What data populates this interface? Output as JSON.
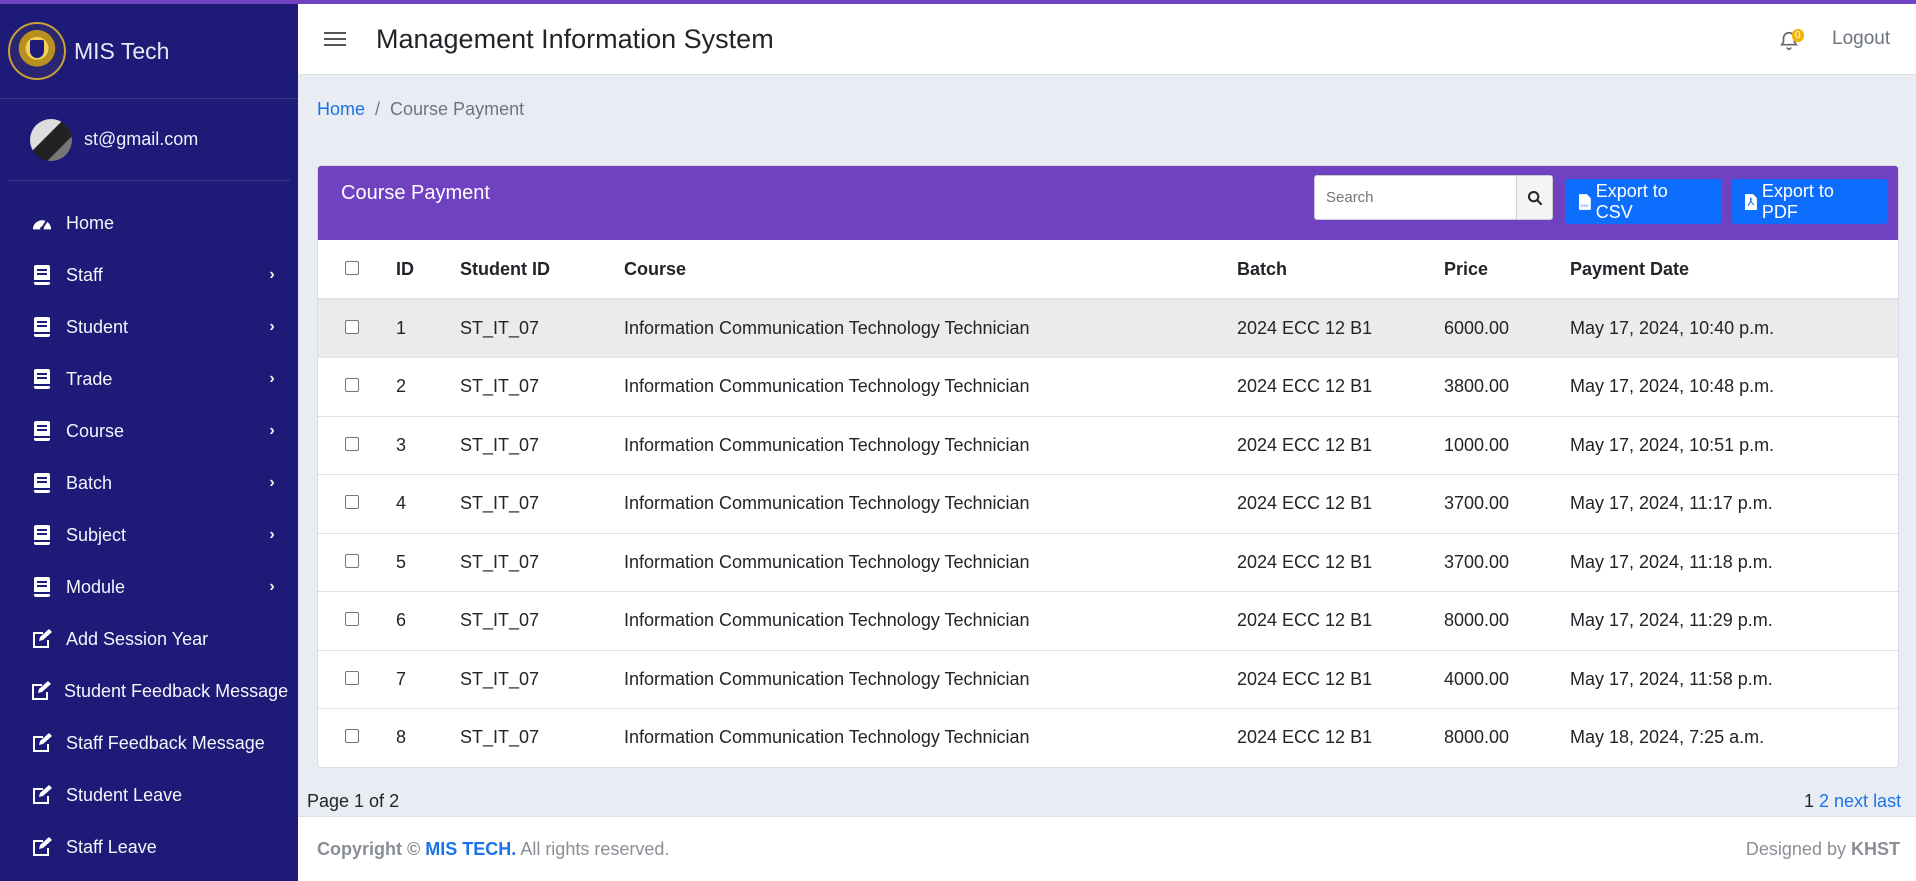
{
  "brand": {
    "name": "MIS Tech"
  },
  "user": {
    "email": "st@gmail.com"
  },
  "sidebar": {
    "items": [
      {
        "label": "Home",
        "icon": "dashboard-icon",
        "has_submenu": false
      },
      {
        "label": "Staff",
        "icon": "book-icon",
        "has_submenu": true
      },
      {
        "label": "Student",
        "icon": "book-icon",
        "has_submenu": true
      },
      {
        "label": "Trade",
        "icon": "book-icon",
        "has_submenu": true
      },
      {
        "label": "Course",
        "icon": "book-icon",
        "has_submenu": true
      },
      {
        "label": "Batch",
        "icon": "book-icon",
        "has_submenu": true
      },
      {
        "label": "Subject",
        "icon": "book-icon",
        "has_submenu": true
      },
      {
        "label": "Module",
        "icon": "book-icon",
        "has_submenu": true
      },
      {
        "label": "Add Session Year",
        "icon": "edit-icon",
        "has_submenu": false
      },
      {
        "label": "Student Feedback Message",
        "icon": "edit-icon",
        "has_submenu": false
      },
      {
        "label": "Staff Feedback Message",
        "icon": "edit-icon",
        "has_submenu": false
      },
      {
        "label": "Student Leave",
        "icon": "edit-icon",
        "has_submenu": false
      },
      {
        "label": "Staff Leave",
        "icon": "edit-icon",
        "has_submenu": false
      }
    ]
  },
  "header": {
    "title": "Management Information System",
    "notification_count": "0",
    "logout_label": "Logout"
  },
  "breadcrumb": {
    "home": "Home",
    "separator": "/",
    "current": "Course Payment"
  },
  "card": {
    "title": "Course Payment",
    "search_placeholder": "Search",
    "export_csv_label": "Export to CSV",
    "export_pdf_label": "Export to PDF"
  },
  "table": {
    "columns": [
      "ID",
      "Student ID",
      "Course",
      "Batch",
      "Price",
      "Payment Date"
    ],
    "rows": [
      {
        "id": "1",
        "student_id": "ST_IT_07",
        "course": "Information Communication Technology Technician",
        "batch": "2024 ECC 12 B1",
        "price": "6000.00",
        "date": "May 17, 2024, 10:40 p.m."
      },
      {
        "id": "2",
        "student_id": "ST_IT_07",
        "course": "Information Communication Technology Technician",
        "batch": "2024 ECC 12 B1",
        "price": "3800.00",
        "date": "May 17, 2024, 10:48 p.m."
      },
      {
        "id": "3",
        "student_id": "ST_IT_07",
        "course": "Information Communication Technology Technician",
        "batch": "2024 ECC 12 B1",
        "price": "1000.00",
        "date": "May 17, 2024, 10:51 p.m."
      },
      {
        "id": "4",
        "student_id": "ST_IT_07",
        "course": "Information Communication Technology Technician",
        "batch": "2024 ECC 12 B1",
        "price": "3700.00",
        "date": "May 17, 2024, 11:17 p.m."
      },
      {
        "id": "5",
        "student_id": "ST_IT_07",
        "course": "Information Communication Technology Technician",
        "batch": "2024 ECC 12 B1",
        "price": "3700.00",
        "date": "May 17, 2024, 11:18 p.m."
      },
      {
        "id": "6",
        "student_id": "ST_IT_07",
        "course": "Information Communication Technology Technician",
        "batch": "2024 ECC 12 B1",
        "price": "8000.00",
        "date": "May 17, 2024, 11:29 p.m."
      },
      {
        "id": "7",
        "student_id": "ST_IT_07",
        "course": "Information Communication Technology Technician",
        "batch": "2024 ECC 12 B1",
        "price": "4000.00",
        "date": "May 17, 2024, 11:58 p.m."
      },
      {
        "id": "8",
        "student_id": "ST_IT_07",
        "course": "Information Communication Technology Technician",
        "batch": "2024 ECC 12 B1",
        "price": "8000.00",
        "date": "May 18, 2024, 7:25 a.m."
      }
    ]
  },
  "pagination": {
    "info": "Page 1 of 2",
    "current": "1",
    "page2": "2",
    "next": "next",
    "last": "last »"
  },
  "footer": {
    "copyright_prefix": "Copyright ©",
    "brand": "MIS TECH.",
    "rights": "All rights reserved.",
    "designed_prefix": "Designed by",
    "designer": "KHST"
  },
  "colors": {
    "sidebar": "#1d1a78",
    "accent": "#6f42c1",
    "primary": "#0d6efd"
  }
}
